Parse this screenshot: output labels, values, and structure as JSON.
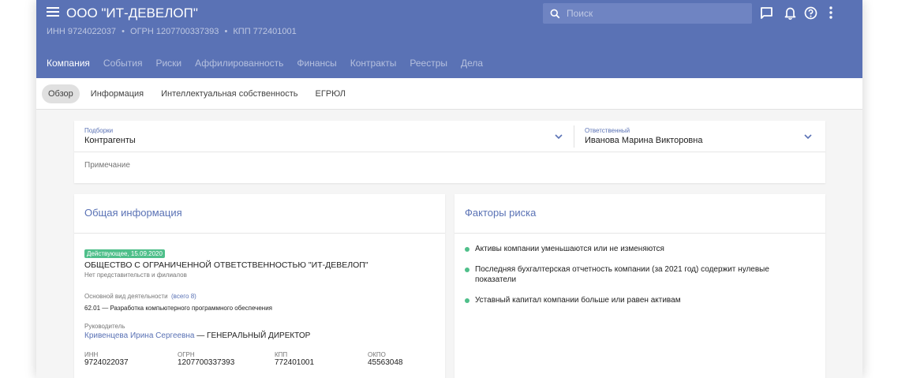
{
  "header": {
    "title": "ООО \"ИТ-ДЕВЕЛОП\"",
    "inn_text": "ИНН 9724022037",
    "ogrn_text": "ОГРН 1207700337393",
    "kpp_text": "КПП 772401001",
    "separator": "•",
    "search_placeholder": "Поиск",
    "tabs": [
      {
        "label": "Компания",
        "active": true
      },
      {
        "label": "События"
      },
      {
        "label": "Риски"
      },
      {
        "label": "Аффилированность"
      },
      {
        "label": "Финансы"
      },
      {
        "label": "Контракты"
      },
      {
        "label": "Реестры"
      },
      {
        "label": "Дела"
      }
    ]
  },
  "subnav": {
    "tabs": [
      {
        "label": "Обзор",
        "active": true
      },
      {
        "label": "Информация"
      },
      {
        "label": "Интеллектуальная собственность"
      },
      {
        "label": "ЕГРЮЛ"
      }
    ]
  },
  "filters": {
    "collections_label": "Подборки",
    "collections_value": "Контрагенты",
    "responsible_label": "Ответственный",
    "responsible_value": "Иванова Марина Викторовна",
    "note_placeholder": "Примечание"
  },
  "general": {
    "title": "Общая информация",
    "status_badge": "Действующее, 15.09.2020",
    "full_name": "ОБЩЕСТВО С ОГРАНИЧЕННОЙ ОТВЕТСТВЕННОСТЬЮ \"ИТ-ДЕВЕЛОП\"",
    "branches": "Нет представительств и филиалов",
    "activity_label": "Основной вид деятельности",
    "activity_all_link": "(всего 8)",
    "activity_value": "62.01 — Разработка компьютерного программного обеспечения",
    "director_label": "Руководитель",
    "director_name": "Кривенцева Ирина Сергеевна",
    "director_position": " — ГЕНЕРАЛЬНЫЙ ДИРЕКТОР",
    "codes": [
      {
        "label": "ИНН",
        "value": "9724022037"
      },
      {
        "label": "ОГРН",
        "value": "1207700337393"
      },
      {
        "label": "КПП",
        "value": "772401001"
      },
      {
        "label": "ОКПО",
        "value": "45563048"
      }
    ]
  },
  "risks": {
    "title": "Факторы риска",
    "items": [
      "Активы компании уменьшаются или не изменяются",
      "Последняя бухгалтерская отчетность компании (за 2021 год) содержит нулевые показатели",
      "Уставный капитал компании больше или равен активам"
    ]
  },
  "icons": [
    "menu-icon",
    "search-icon",
    "chat-icon",
    "bell-icon",
    "help-icon",
    "more-vert-icon",
    "chevron-down-icon"
  ],
  "colors": {
    "header": "#5a72b5",
    "accent": "#5a72b5",
    "status_green": "#4fbf8a"
  }
}
